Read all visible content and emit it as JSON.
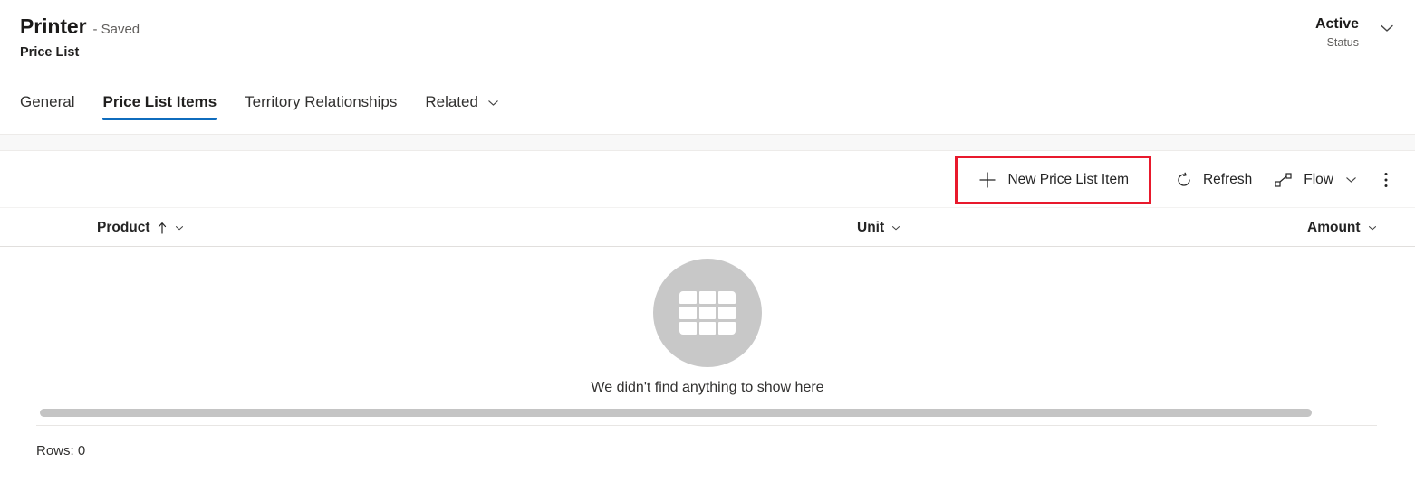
{
  "header": {
    "record_title": "Printer",
    "saved_state": "- Saved",
    "entity_name": "Price List",
    "status_value": "Active",
    "status_label": "Status",
    "status_chevron_icon": "chevron-down-icon"
  },
  "tabs": [
    {
      "label": "General",
      "active": false,
      "has_chevron": false
    },
    {
      "label": "Price List Items",
      "active": true,
      "has_chevron": false
    },
    {
      "label": "Territory Relationships",
      "active": false,
      "has_chevron": false
    },
    {
      "label": "Related",
      "active": false,
      "has_chevron": true
    }
  ],
  "commandbar": {
    "new_item": {
      "label": "New Price List Item",
      "icon": "plus-icon",
      "highlighted": true
    },
    "refresh": {
      "label": "Refresh",
      "icon": "refresh-icon"
    },
    "flow": {
      "label": "Flow",
      "icon": "flow-icon",
      "chevron": "chevron-down-icon"
    },
    "overflow": {
      "icon": "more-vertical-icon"
    }
  },
  "grid": {
    "columns": [
      {
        "label": "Product",
        "sort": "ascending",
        "sort_icon": "arrow-up-icon",
        "chevron": "chevron-down-icon"
      },
      {
        "label": "Unit",
        "sort": "none",
        "chevron": "chevron-down-icon"
      },
      {
        "label": "Amount",
        "sort": "none",
        "chevron": "chevron-down-icon"
      }
    ],
    "rows": [],
    "empty_state": {
      "icon": "grid-table-icon",
      "message": "We didn't find anything to show here"
    },
    "footer": {
      "rows_label": "Rows: 0"
    }
  },
  "colors": {
    "accent": "#0f6cbd",
    "highlight_box": "#e8192c",
    "empty_circle": "#c8c8c8",
    "text_primary": "#242424",
    "text_secondary": "#605e5c"
  }
}
